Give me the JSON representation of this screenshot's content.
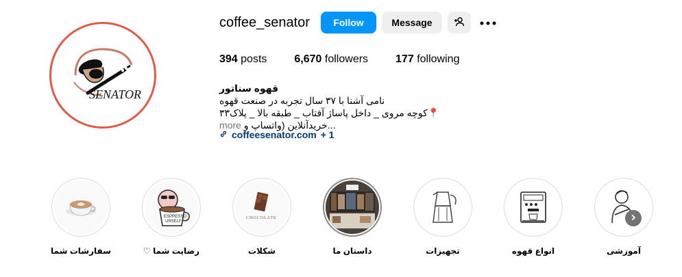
{
  "profile": {
    "username": "coffee_senator",
    "avatar_text": "SENATOR",
    "ring_color": "#de5a4a"
  },
  "actions": {
    "follow": "Follow",
    "message": "Message",
    "add_user_icon": "person-plus-icon",
    "more_icon": "more-dots-icon",
    "follow_color": "#0095f6"
  },
  "stats": {
    "posts_count": "394",
    "posts_label": "posts",
    "followers_count": "6,670",
    "followers_label": "followers",
    "following_count": "177",
    "following_label": "following"
  },
  "bio": {
    "name": "قهوه سناتور",
    "line1": "نامی آشنا با ۳۷ سال تجربه در صنعت قهوه",
    "line2": "📍کوچه مروی _ داخل پاساژ آفتاب _ طبقه بالا _ پلاک۳۳",
    "line3": "...خریدآنلاین (واتساپ و",
    "more": "more",
    "link": "coffeesenator.com",
    "link_extra": "+ 1"
  },
  "highlights": [
    {
      "label": "سفارشات شما",
      "icon": "latte-art-icon"
    },
    {
      "label": "رضایت شما ♡",
      "icon": "espresso-yourself-icon"
    },
    {
      "label": "شکلات",
      "icon": "chocolate-icon"
    },
    {
      "label": "داستان ما",
      "icon": "shop-photo-icon"
    },
    {
      "label": "تجهیزات",
      "icon": "moka-pot-icon"
    },
    {
      "label": "انواع قهوه",
      "icon": "espresso-machine-icon"
    },
    {
      "label": "آموزشی",
      "icon": "barista-icon"
    }
  ],
  "nav": {
    "next_icon": "chevron-right-icon"
  }
}
